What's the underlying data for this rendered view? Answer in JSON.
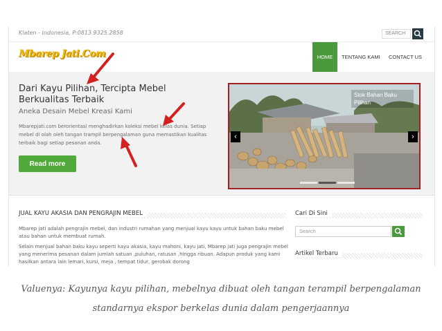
{
  "topbar": {
    "contact": "Klaten - Indonesia, P:0813.9325.2858",
    "search_placeholder": "SEARCH"
  },
  "header": {
    "logo_text": "Mbarep Jati.Com",
    "nav": [
      {
        "label": "HOME",
        "active": true
      },
      {
        "label": "TENTANG KAMI",
        "active": false
      },
      {
        "label": "CONTACT US",
        "active": false
      }
    ]
  },
  "hero": {
    "title": "Dari Kayu Pilihan, Tercipta Mebel Berkualitas Terbaik",
    "subtitle": "Aneka Desain Mebel Kreasi Kami",
    "description": "Mbarepjati.com berorientasi menghadirkan koleksi mebel kelas dunia. Setiap mebel di olah oleh tangan trampil berpengalaman guna memastikan kualitas terbaik bagi setiap pesanan anda.",
    "cta": "Read more",
    "slide_caption": "Stok Bahan Baku Pilihan",
    "slider_active": 2,
    "slider_count": 3
  },
  "main": {
    "title": "JUAL KAYU AKASIA DAN PENGRAJIN MEBEL",
    "paragraph1": "Mbarep jati adalah pengrajin mebel, dan industri rumahan yang menjual kayu kayu untuk bahan baku mebel atau bahan untuk membuat rumah.",
    "paragraph2": "Selain menjual bahan baku kayu seperti kayu akasia, kayu mahoni, kayu jati, Mbarep jati juga pengrajin mebel yang menerima pesanan dalam jumlah satuan ,puluhan, ratusan ,hingga ribuan. Adapun produk yang kami hasilkan antara lain lemari, kursi, meja , tempat tidur, gerobak dorong"
  },
  "sidebar": {
    "search_title": "Cari Di Sini",
    "search_placeholder": "Search",
    "recent_title": "Artikel Terbaru"
  },
  "caption": "Valuenya: Kayunya kayu pilihan, mebelnya dibuat oleh tangan terampil berpengalaman standarnya ekspor berkelas dunia dalam pengerjaannya",
  "colors": {
    "accent_green": "#51a939",
    "annotation_red": "#d32020",
    "logo_yellow": "#f2b500"
  }
}
